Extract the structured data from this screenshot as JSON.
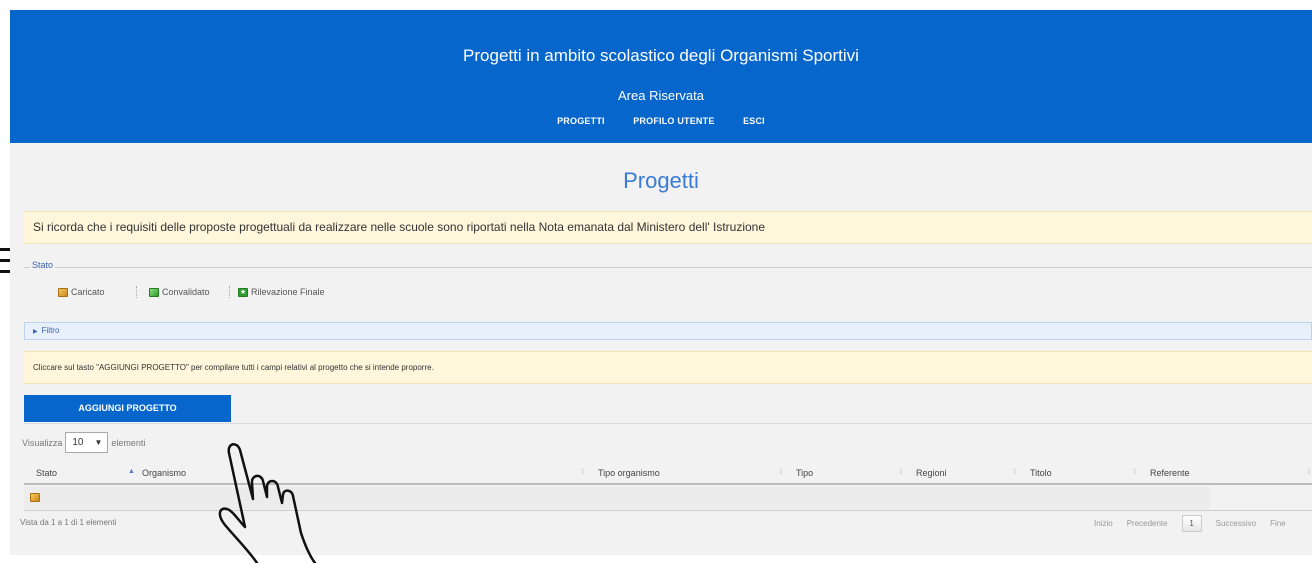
{
  "header": {
    "title": "Progetti in ambito scolastico degli Organismi Sportivi",
    "subtitle": "Area Riservata",
    "nav": [
      "PROGETTI",
      "PROFILO UTENTE",
      "ESCI"
    ]
  },
  "page_title": "Progetti",
  "notice": "Si ricorda che i requisiti delle proposte progettuali da realizzare nelle scuole sono riportati nella Nota emanata dal Ministero dell' Istruzione",
  "stato": {
    "title": "Stato",
    "items": [
      {
        "label": "Caricato",
        "icon": "orange-folder-icon"
      },
      {
        "label": "Convalidato",
        "icon": "green-folder-icon"
      },
      {
        "label": "Rilevazione Finale",
        "icon": "green-star-icon"
      }
    ]
  },
  "filtro_label": "Filtro",
  "info": "Cliccare sul tasto \"AGGIUNGI PROGETTO\" per compilare tutti i campi relativi al progetto che si intende proporre.",
  "add_button": "AGGIUNGI PROGETTO",
  "visualizza": {
    "prefix": "Visualizza",
    "value": "10",
    "suffix": "elementi"
  },
  "table": {
    "columns": [
      "Stato",
      "Organismo",
      "Tipo organismo",
      "Tipo",
      "Regioni",
      "Titolo",
      "Referente"
    ],
    "rows": [
      {
        "stato_icon": "orange-folder-icon"
      }
    ]
  },
  "footer": {
    "summary": "Vista da 1 a 1 di 1 elementi",
    "pager": {
      "first": "Inizio",
      "prev": "Precedente",
      "page": "1",
      "next": "Successivo",
      "last": "Fine"
    }
  },
  "colors": {
    "primary": "#0766cc",
    "notice_bg": "#fff6dc",
    "title_blue": "#3a7bd5"
  }
}
